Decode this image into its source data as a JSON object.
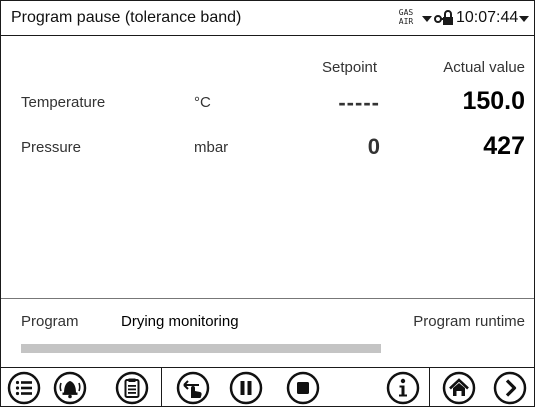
{
  "header": {
    "title": "Program pause (tolerance band)",
    "gas_mode_top": "GAS",
    "gas_mode_bottom": "AIR",
    "time": "10:07:44"
  },
  "columns": {
    "setpoint": "Setpoint",
    "actual": "Actual value"
  },
  "rows": [
    {
      "label": "Temperature",
      "unit": "°C",
      "setpoint": "-----",
      "actual": "150.0"
    },
    {
      "label": "Pressure",
      "unit": "mbar",
      "setpoint": "0",
      "actual": "427"
    }
  ],
  "program": {
    "label": "Program",
    "name": "Drying monitoring",
    "runtime_label": "Program runtime",
    "progress_fraction": 0.0
  },
  "toolbar": {
    "icons": [
      "menu-icon",
      "alarm-icon",
      "clipboard-icon",
      "touch-icon",
      "pause-icon",
      "stop-icon",
      "info-icon",
      "home-icon",
      "next-icon"
    ]
  },
  "colors": {
    "frame": "#1a1a1a",
    "progress_bar": "#c4c4c4"
  }
}
